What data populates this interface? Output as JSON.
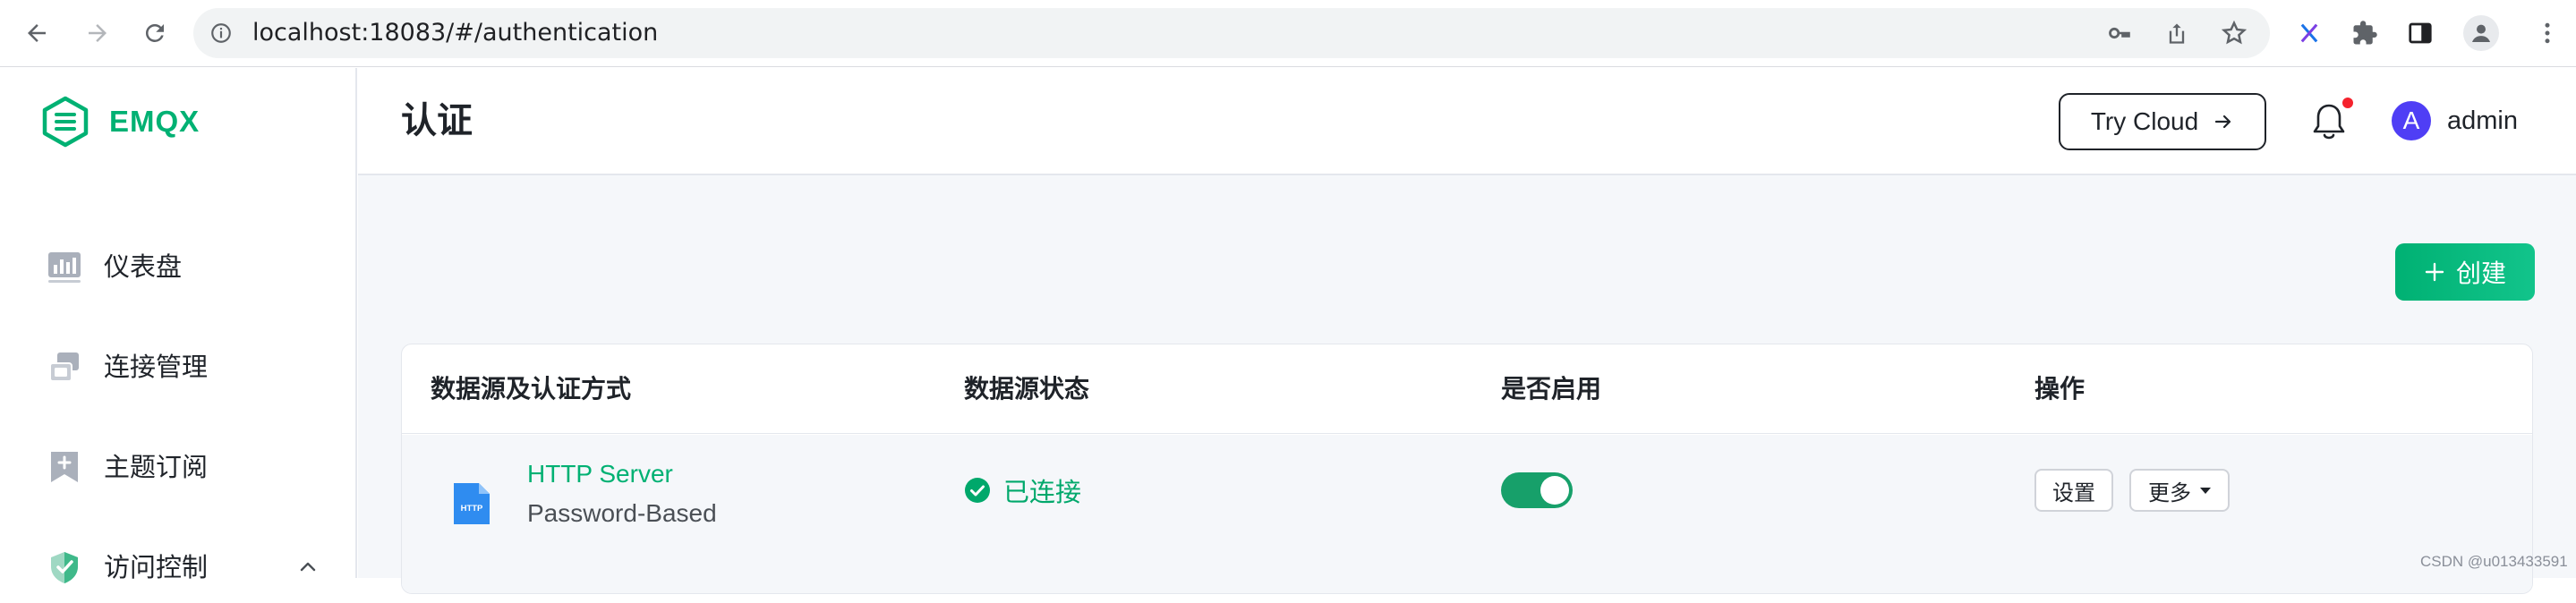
{
  "browser": {
    "url": "localhost:18083/#/authentication"
  },
  "sidebar": {
    "logo_text": "EMQX",
    "items": [
      {
        "label": "仪表盘",
        "icon": "dashboard-icon"
      },
      {
        "label": "连接管理",
        "icon": "connections-icon"
      },
      {
        "label": "主题订阅",
        "icon": "subscriptions-icon"
      },
      {
        "label": "访问控制",
        "icon": "shield-check-icon"
      }
    ]
  },
  "header": {
    "title": "认证",
    "try_cloud_label": "Try Cloud",
    "user_initial": "A",
    "username": "admin"
  },
  "main": {
    "create_label": "创建",
    "table": {
      "columns": [
        "数据源及认证方式",
        "数据源状态",
        "是否启用",
        "操作"
      ],
      "rows": [
        {
          "icon_text": "HTTP",
          "backend": "HTTP Server",
          "mechanism": "Password-Based",
          "status": "已连接",
          "enabled": true,
          "settings_label": "设置",
          "more_label": "更多"
        }
      ]
    }
  },
  "watermark": "CSDN @u013433591",
  "colors": {
    "accent": "#00b173",
    "status_ok": "#00a86b",
    "toggle_on": "#17a06a",
    "avatar": "#4f3ef5",
    "notification_dot": "#f5222d"
  }
}
